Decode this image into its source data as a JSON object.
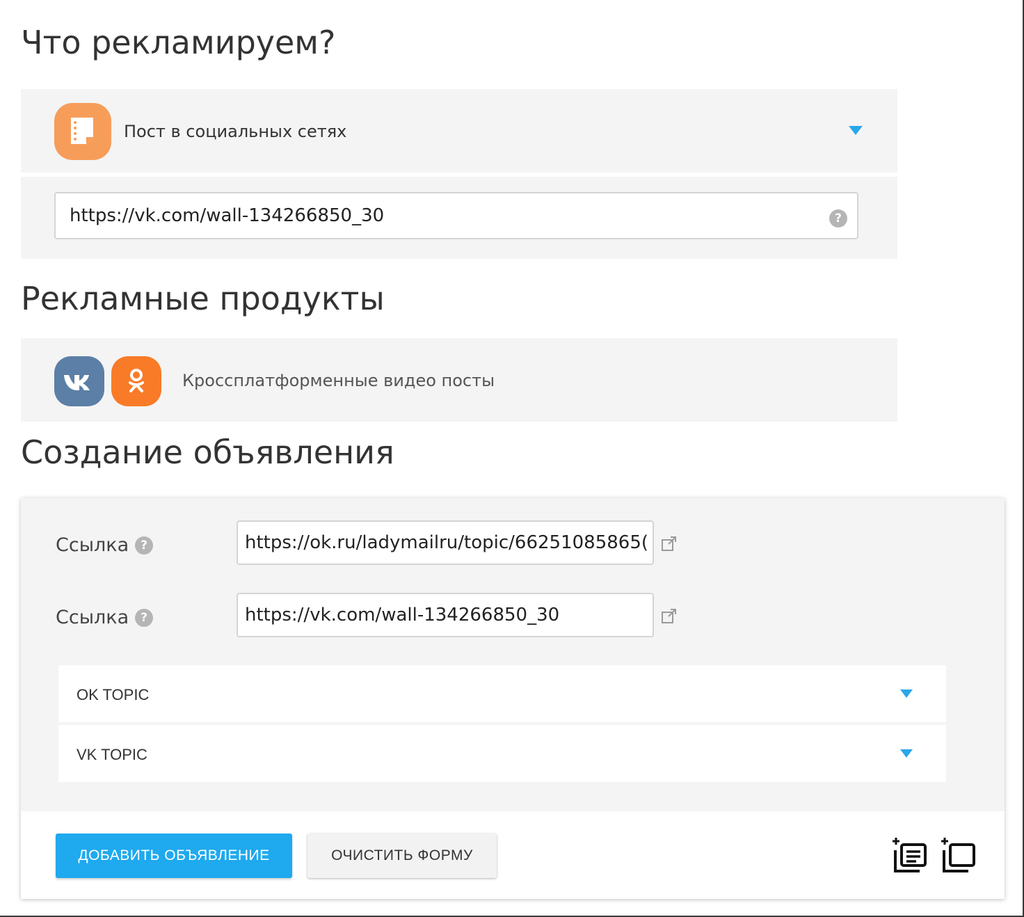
{
  "sections": {
    "what_title": "Что рекламируем?",
    "products_title": "Рекламные продукты",
    "create_title": "Создание объявления"
  },
  "object": {
    "type_label": "Пост в социальных сетях",
    "url_value": "https://vk.com/wall-134266850_30",
    "help": "?"
  },
  "products": {
    "label": "Кроссплатформенные видео посты",
    "platforms": [
      "vk",
      "ok"
    ]
  },
  "ad_form": {
    "links": [
      {
        "label": "Ссылка",
        "value": "https://ok.ru/ladymailru/topic/66251085865("
      },
      {
        "label": "Ссылка",
        "value": "https://vk.com/wall-134266850_30"
      }
    ],
    "help": "?",
    "topics": [
      {
        "label": "OK TOPIC"
      },
      {
        "label": "VK TOPIC"
      }
    ],
    "add_button": "ДОБАВИТЬ ОБЪЯВЛЕНИЕ",
    "clear_button": "ОЧИСТИТЬ ФОРМУ"
  },
  "colors": {
    "accent": "#1fa9ee",
    "caret": "#2aa7e8",
    "vk": "#5b7fa6",
    "ok": "#f97b27",
    "post_icon": "#f79d5a",
    "panel": "#f4f4f4"
  },
  "icons": [
    "post-icon",
    "vk-icon",
    "ok-icon",
    "help-icon",
    "external-link-icon",
    "chevron-down-icon",
    "add-multiple-ads-icon",
    "add-copy-ad-icon"
  ]
}
